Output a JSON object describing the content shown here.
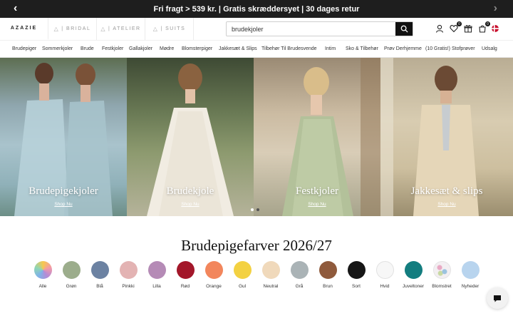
{
  "promo": {
    "text": "Fri fragt > 539 kr. | Gratis skræddersyet | 30 dages retur"
  },
  "header": {
    "brands": [
      {
        "label": "AZAZIE"
      },
      {
        "label": "| BRIDAL"
      },
      {
        "label": "| ATELIER"
      },
      {
        "label": "| SUITS"
      }
    ],
    "search_value": "brudekjoler",
    "wishlist_count": "0",
    "cart_count": "0"
  },
  "nav": {
    "items": [
      {
        "label": "Brudepiger"
      },
      {
        "label": "Sommerkjoler"
      },
      {
        "label": "Brude"
      },
      {
        "label": "Festkjoler"
      },
      {
        "label": "Gallakjoler"
      },
      {
        "label": "Mødre"
      },
      {
        "label": "Blomsterpiger"
      },
      {
        "label": "Jakkesæt & Slips"
      },
      {
        "label": "Tilbehør Til Brudesvende"
      },
      {
        "label": "Intim"
      },
      {
        "label": "Sko & Tilbehør"
      },
      {
        "label": "Prøv Derhjemme"
      },
      {
        "label": "(10 Gratis!) Stofprøver"
      },
      {
        "label": "Udsalg"
      }
    ]
  },
  "hero": {
    "panels": [
      {
        "title": "Brudepigekjoler",
        "cta": "Shop Nu"
      },
      {
        "title": "Brudekjole",
        "cta": "Shop Nu"
      },
      {
        "title": "Festkjoler",
        "cta": "Shop Nu"
      },
      {
        "title": "Jakkesæt & slips",
        "cta": "Shop Nu"
      }
    ]
  },
  "colors": {
    "title": "Brudepigefarver 2026/27",
    "items": [
      {
        "label": "Alle",
        "color": "conic"
      },
      {
        "label": "Grøn",
        "color": "#9cad8c"
      },
      {
        "label": "Blå",
        "color": "#6c82a2"
      },
      {
        "label": "Pinkki",
        "color": "#e3b3b3"
      },
      {
        "label": "Lilla",
        "color": "#b58bb6"
      },
      {
        "label": "Rød",
        "color": "#a3172a"
      },
      {
        "label": "Orange",
        "color": "#f2865c"
      },
      {
        "label": "Gul",
        "color": "#f3d142"
      },
      {
        "label": "Neutral",
        "color": "#f0d9bb"
      },
      {
        "label": "Grå",
        "color": "#aab3b6"
      },
      {
        "label": "Brun",
        "color": "#8f5a3c"
      },
      {
        "label": "Sort",
        "color": "#161616"
      },
      {
        "label": "Hvid",
        "color": "#f7f7f7"
      },
      {
        "label": "Juveltoner",
        "color": "#137d7f"
      },
      {
        "label": "Blomstret",
        "color": "floral"
      },
      {
        "label": "Nyheder",
        "color": "#b8d4ee"
      }
    ]
  }
}
